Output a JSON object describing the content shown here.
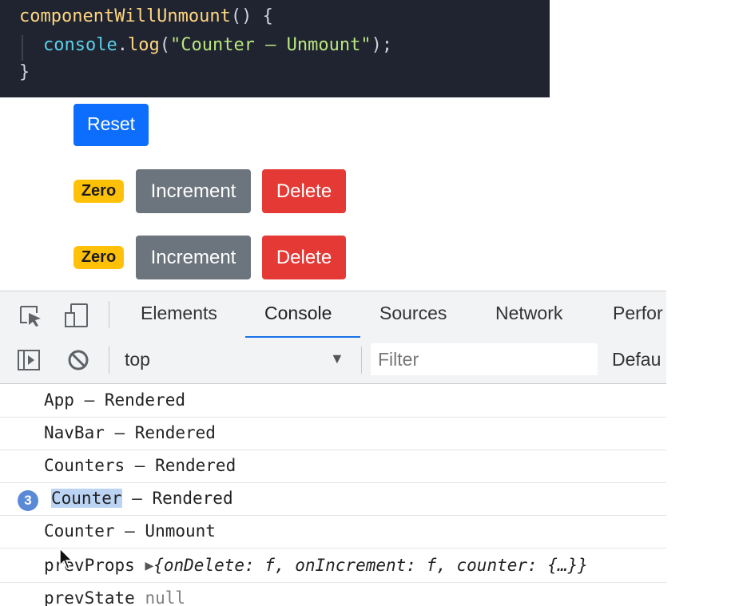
{
  "code": {
    "line1_fn": "componentWillUnmount",
    "line1_punc": "() {",
    "line2_obj": "console",
    "line2_dot": ".",
    "line2_method": "log",
    "line2_open": "(",
    "line2_str": "\"Counter – Unmount\"",
    "line2_close": ");",
    "line3": "}"
  },
  "app": {
    "reset_label": "Reset",
    "counters": [
      {
        "badge": "Zero",
        "increment_label": "Increment",
        "delete_label": "Delete"
      },
      {
        "badge": "Zero",
        "increment_label": "Increment",
        "delete_label": "Delete"
      }
    ]
  },
  "devtools": {
    "tabs": [
      "Elements",
      "Console",
      "Sources",
      "Network",
      "Perfor"
    ],
    "active_tab": "Console",
    "context": "top",
    "filter_placeholder": "Filter",
    "levels": "Defau",
    "messages": [
      {
        "text": "App – Rendered"
      },
      {
        "text": "NavBar – Rendered"
      },
      {
        "text": "Counters – Rendered"
      },
      {
        "count": "3",
        "highlight": "Counter",
        "text": " – Rendered"
      },
      {
        "text": "Counter – Unmount"
      },
      {
        "label": "prevProps ",
        "object": "{onDelete: f, onIncrement: f, counter: {…}}"
      },
      {
        "label": "prevState ",
        "value": "null"
      }
    ]
  },
  "colors": {
    "primary": "#0d6efd",
    "secondary": "#6c757d",
    "danger": "#e53935",
    "warning": "#ffc107",
    "editor_bg": "#1f2430",
    "tab_accent": "#1a73e8"
  }
}
